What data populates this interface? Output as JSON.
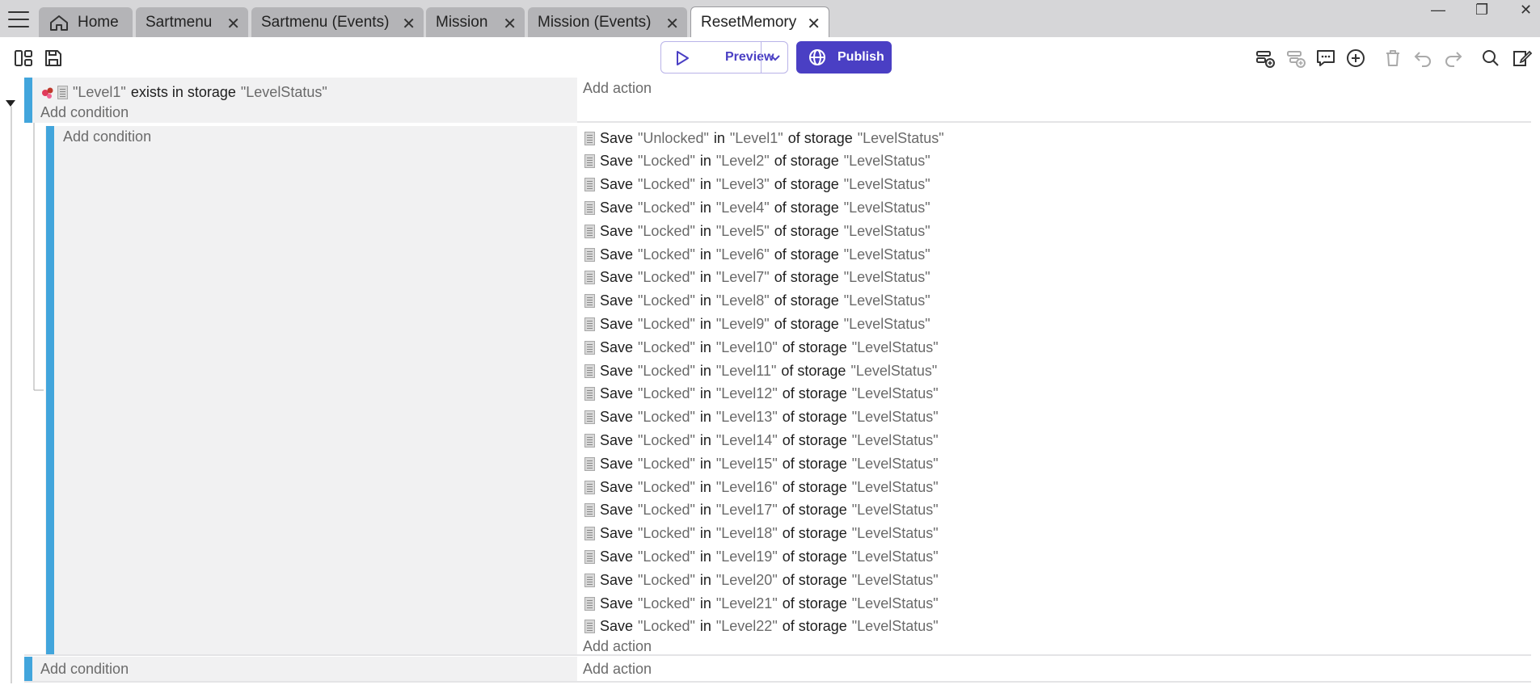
{
  "tabs": [
    {
      "label": "Home",
      "closable": false,
      "active": false
    },
    {
      "label": "Sartmenu",
      "closable": true,
      "active": false
    },
    {
      "label": "Sartmenu (Events)",
      "closable": true,
      "active": false
    },
    {
      "label": "Mission",
      "closable": true,
      "active": false
    },
    {
      "label": "Mission (Events)",
      "closable": true,
      "active": false
    },
    {
      "label": "ResetMemory",
      "closable": true,
      "active": true
    }
  ],
  "toolbar": {
    "preview_label": "Preview",
    "publish_label": "Publish"
  },
  "colors": {
    "accent": "#4a3fc4",
    "event_bar": "#42a5dc",
    "tabbar": "#d6d6d8"
  },
  "events": {
    "event1": {
      "condition": {
        "quote1": "\"Level1\"",
        "mid": "exists in storage",
        "quote2": "\"LevelStatus\""
      },
      "add_condition": "Add condition",
      "add_action": "Add action"
    },
    "subevent": {
      "add_condition": "Add condition",
      "actions": [
        {
          "value": "\"Unlocked\"",
          "key": "\"Level1\""
        },
        {
          "value": "\"Locked\"",
          "key": "\"Level2\""
        },
        {
          "value": "\"Locked\"",
          "key": "\"Level3\""
        },
        {
          "value": "\"Locked\"",
          "key": "\"Level4\""
        },
        {
          "value": "\"Locked\"",
          "key": "\"Level5\""
        },
        {
          "value": "\"Locked\"",
          "key": "\"Level6\""
        },
        {
          "value": "\"Locked\"",
          "key": "\"Level7\""
        },
        {
          "value": "\"Locked\"",
          "key": "\"Level8\""
        },
        {
          "value": "\"Locked\"",
          "key": "\"Level9\""
        },
        {
          "value": "\"Locked\"",
          "key": "\"Level10\""
        },
        {
          "value": "\"Locked\"",
          "key": "\"Level11\""
        },
        {
          "value": "\"Locked\"",
          "key": "\"Level12\""
        },
        {
          "value": "\"Locked\"",
          "key": "\"Level13\""
        },
        {
          "value": "\"Locked\"",
          "key": "\"Level14\""
        },
        {
          "value": "\"Locked\"",
          "key": "\"Level15\""
        },
        {
          "value": "\"Locked\"",
          "key": "\"Level16\""
        },
        {
          "value": "\"Locked\"",
          "key": "\"Level17\""
        },
        {
          "value": "\"Locked\"",
          "key": "\"Level18\""
        },
        {
          "value": "\"Locked\"",
          "key": "\"Level19\""
        },
        {
          "value": "\"Locked\"",
          "key": "\"Level20\""
        },
        {
          "value": "\"Locked\"",
          "key": "\"Level21\""
        },
        {
          "value": "\"Locked\"",
          "key": "\"Level22\""
        }
      ],
      "action_words": {
        "save": "Save",
        "in": "in",
        "of_storage": "of storage",
        "storage_name": "\"LevelStatus\""
      },
      "add_action": "Add action"
    },
    "event3": {
      "add_condition": "Add condition",
      "add_action": "Add action"
    }
  }
}
